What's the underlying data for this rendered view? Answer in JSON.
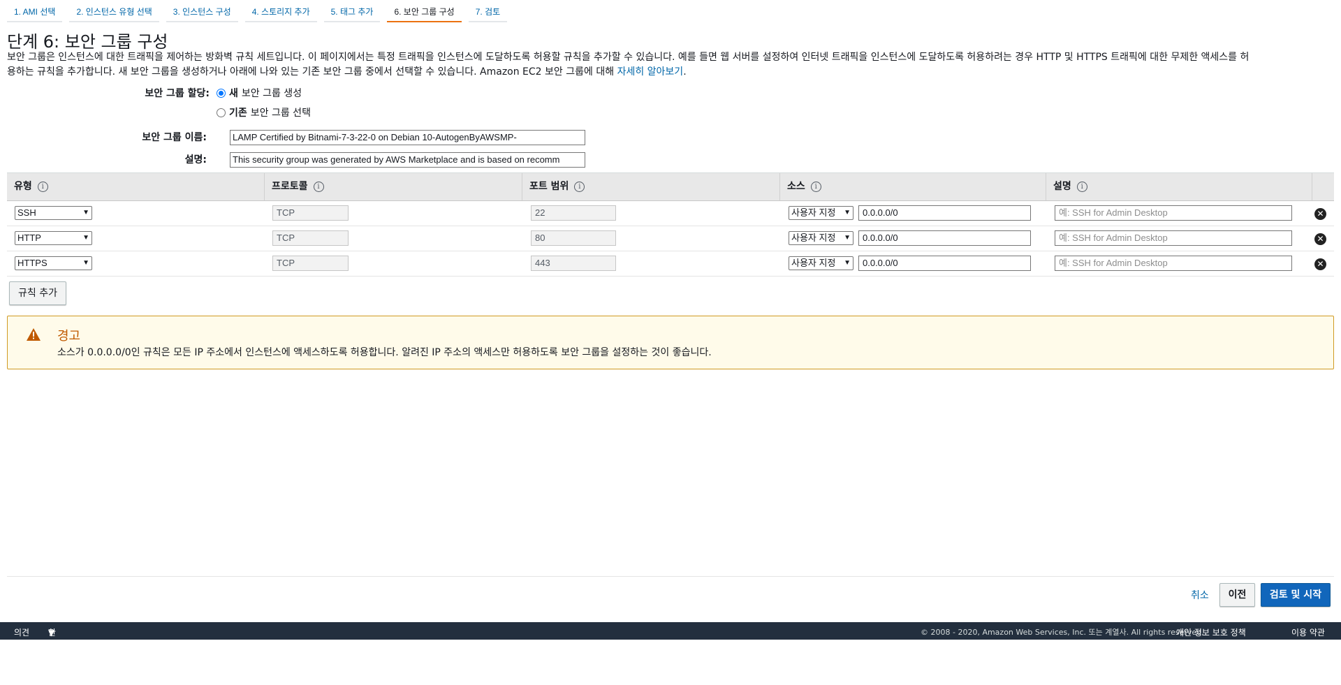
{
  "wizard": {
    "steps": [
      "1. AMI 선택",
      "2. 인스턴스 유형 선택",
      "3. 인스턴스 구성",
      "4. 스토리지 추가",
      "5. 태그 추가",
      "6. 보안 그룹 구성",
      "7. 검토"
    ],
    "active_step": 5
  },
  "page": {
    "title": "단계 6: 보안 그룹 구성",
    "intro_line1": "보안 그룹은 인스턴스에 대한 트래픽을 제어하는 방화벽 규칙 세트입니다. 이 페이지에서는 특정 트래픽을 인스턴스에 도달하도록 허용할 규칙을 추가할 수 있습니다. 예를 들면 웹 서버를 설정하여 인터넷 트래픽을 인스턴스에 도달하도록 허용하려는 경우 HTTP 및 HTTPS 트래픽에 대한 무제한 액세스를 허",
    "intro_line2": "용하는 규칙을 추가합니다. 새 보안 그룹을 생성하거나 아래에 나와 있는 기존 보안 그룹 중에서 선택할 수 있습니다. Amazon EC2 보안 그룹에 대해 ",
    "learn_more": "자세히 알아보기",
    "intro_end": "."
  },
  "form": {
    "assign_label": "보안 그룹 할당:",
    "option_new_bold": "새",
    "option_new_rest": "보안 그룹 생성",
    "option_existing_bold": "기존",
    "option_existing_rest": "보안 그룹 선택",
    "selected_option": "new",
    "name_label": "보안 그룹 이름:",
    "name_value": "LAMP Certified by Bitnami-7-3-22-0 on Debian 10-AutogenByAWSMP-",
    "desc_label": "설명:",
    "desc_value": "This security group was generated by AWS Marketplace and is based on recomm"
  },
  "table": {
    "headers": [
      "유형",
      "프로토콜",
      "포트 범위",
      "소스",
      "설명"
    ],
    "rows": [
      {
        "type": "SSH",
        "protocol": "TCP",
        "port": "22",
        "source_type": "사용자 지정",
        "source": "0.0.0.0/0",
        "desc_placeholder": "예: SSH for Admin Desktop"
      },
      {
        "type": "HTTP",
        "protocol": "TCP",
        "port": "80",
        "source_type": "사용자 지정",
        "source": "0.0.0.0/0",
        "desc_placeholder": "예: SSH for Admin Desktop"
      },
      {
        "type": "HTTPS",
        "protocol": "TCP",
        "port": "443",
        "source_type": "사용자 지정",
        "source": "0.0.0.0/0",
        "desc_placeholder": "예: SSH for Admin Desktop"
      }
    ],
    "add_rule_label": "규칙 추가"
  },
  "warning": {
    "title": "경고",
    "body": "소스가 0.0.0.0/0인 규칙은 모든 IP 주소에서 인스턴스에 액세스하도록 허용합니다. 알려진 IP 주소의 액세스만 허용하도록 보안 그룹을 설정하는 것이 좋습니다."
  },
  "actions": {
    "cancel": "취소",
    "previous": "이전",
    "review_launch": "검토 및 시작"
  },
  "footer": {
    "feedback": "의견",
    "language": "한국어",
    "copyright": "© 2008 - 2020, Amazon Web Services, Inc. 또는 계열사. All rights reserved.",
    "privacy": "개인 정보 보호 정책",
    "terms": "이용 약관"
  },
  "colors": {
    "link": "#0066a8",
    "active_tab_underline": "#ec7211",
    "primary_button": "#1166bb",
    "warning_border": "#d09a23",
    "warning_title": "#c05a00",
    "footer_bg": "#232f3e"
  }
}
